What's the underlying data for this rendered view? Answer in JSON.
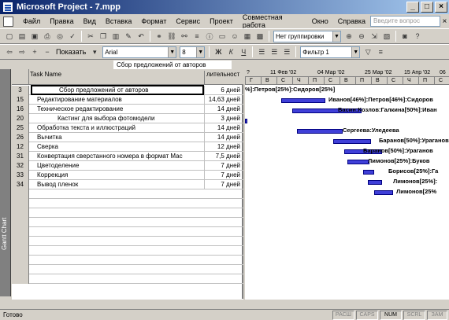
{
  "window": {
    "title": "Microsoft Project - 7.mpp"
  },
  "menu": {
    "items": [
      "Файл",
      "Правка",
      "Вид",
      "Вставка",
      "Формат",
      "Сервис",
      "Проект",
      "Совместная работа",
      "Окно",
      "Справка"
    ],
    "ask_placeholder": "Введите вопрос"
  },
  "toolbar": {
    "grouping": "Нет группировки",
    "show_label": "Показать",
    "font": "Arial",
    "font_size": "8",
    "filter": "Фильтр 1"
  },
  "entry": {
    "value": "Сбор предложений от авторов"
  },
  "view_label": "Gantt Chart",
  "table": {
    "headers": {
      "name": "Task Name",
      "duration": "лительност"
    },
    "rows": [
      {
        "id": "3",
        "name": "Сбор предложений от авторов",
        "duration": "6 дней",
        "indent": 2
      },
      {
        "id": "15",
        "name": "Редактирование материалов",
        "duration": "14,63 дней",
        "indent": 1
      },
      {
        "id": "16",
        "name": "Техническое редактирование",
        "duration": "14 дней",
        "indent": 1
      },
      {
        "id": "20",
        "name": "Кастинг для выбора фотомодели",
        "duration": "3 дней",
        "indent": 2
      },
      {
        "id": "25",
        "name": "Обработка текста и иллюстраций",
        "duration": "14 дней",
        "indent": 1
      },
      {
        "id": "26",
        "name": "Вычитка",
        "duration": "14 дней",
        "indent": 1
      },
      {
        "id": "12",
        "name": "Сверка",
        "duration": "12 дней",
        "indent": 1
      },
      {
        "id": "31",
        "name": "Конвертация сверстанного номера в формат Мас",
        "duration": "7,5 дней",
        "indent": 1
      },
      {
        "id": "32",
        "name": "Цветоделение",
        "duration": "7 дней",
        "indent": 1
      },
      {
        "id": "33",
        "name": "Коррекция",
        "duration": "7 дней",
        "indent": 1
      },
      {
        "id": "34",
        "name": "Вывод пленок",
        "duration": "7 дней",
        "indent": 1
      }
    ]
  },
  "gantt": {
    "weeks": [
      "?",
      "11 Фев '02",
      "04 Мар '02",
      "25 Мар '02",
      "15 Апр '02",
      "06"
    ],
    "days": [
      "Г",
      "В",
      "С",
      "Ч",
      "П",
      "С",
      "В",
      "П",
      "В",
      "С",
      "Ч",
      "П",
      "С"
    ],
    "labels": [
      "%]:Петров[25%]:Сидоров[25%]",
      "Иванов[46%]:Петров[46%]:Сидоров",
      "Васин:Козлов:Галкина[50%]:Иван",
      "",
      "Сергеева:Уледеева",
      "Баранов[50%]:Ураганов[50%",
      "Баранов[50%]:Ураганов",
      "Лимонов[25%]:Буков",
      "Борисов[25%]:Га",
      "Лимонов[25%]:",
      "Лимонов[25%"
    ]
  },
  "status": {
    "ready": "Готово",
    "indicators": [
      "РАСШ",
      "CAPS",
      "NUM",
      "SCRL",
      "ЗАМ"
    ]
  }
}
